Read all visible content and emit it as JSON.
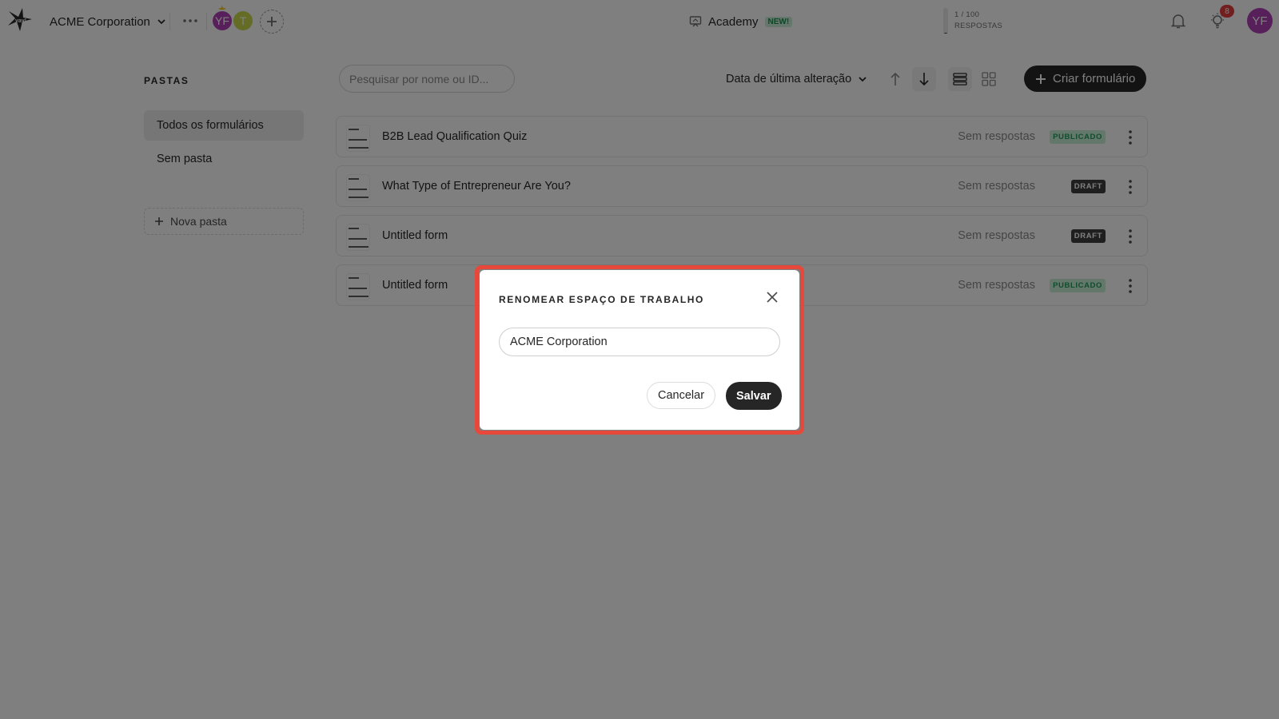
{
  "header": {
    "workspace_name": "ACME Corporation",
    "members": [
      {
        "initials": "YF",
        "color": "#b040b5"
      },
      {
        "initials": "T",
        "color": "#c8d94a"
      }
    ],
    "academy_label": "Academy",
    "academy_badge": "NEW!",
    "responses_count": "1 / 100",
    "responses_label": "RESPOSTAS",
    "responses_used_fraction": 0.01,
    "notification_count": "8",
    "user_initials": "YF"
  },
  "sidebar": {
    "heading": "PASTAS",
    "items": [
      {
        "label": "Todos os formulários",
        "active": true
      },
      {
        "label": "Sem pasta",
        "active": false
      }
    ],
    "new_folder_label": "Nova pasta"
  },
  "toolbar": {
    "search_placeholder": "Pesquisar por nome ou ID...",
    "sort_label": "Data de última alteração",
    "create_label": "Criar formulário"
  },
  "forms": [
    {
      "title": "B2B Lead Qualification Quiz",
      "responses": "Sem respostas",
      "status": "PUBLICADO"
    },
    {
      "title": "What Type of Entrepreneur Are You?",
      "responses": "Sem respostas",
      "status": "DRAFT"
    },
    {
      "title": "Untitled form",
      "responses": "Sem respostas",
      "status": "DRAFT"
    },
    {
      "title": "Untitled form",
      "responses": "Sem respostas",
      "status": "PUBLICADO"
    }
  ],
  "modal": {
    "title": "RENOMEAR ESPAÇO DE TRABALHO",
    "input_value": "ACME Corporation",
    "cancel_label": "Cancelar",
    "save_label": "Salvar"
  },
  "colors": {
    "highlight": "#e8483a",
    "published": "#22995a",
    "dark": "#262627"
  }
}
